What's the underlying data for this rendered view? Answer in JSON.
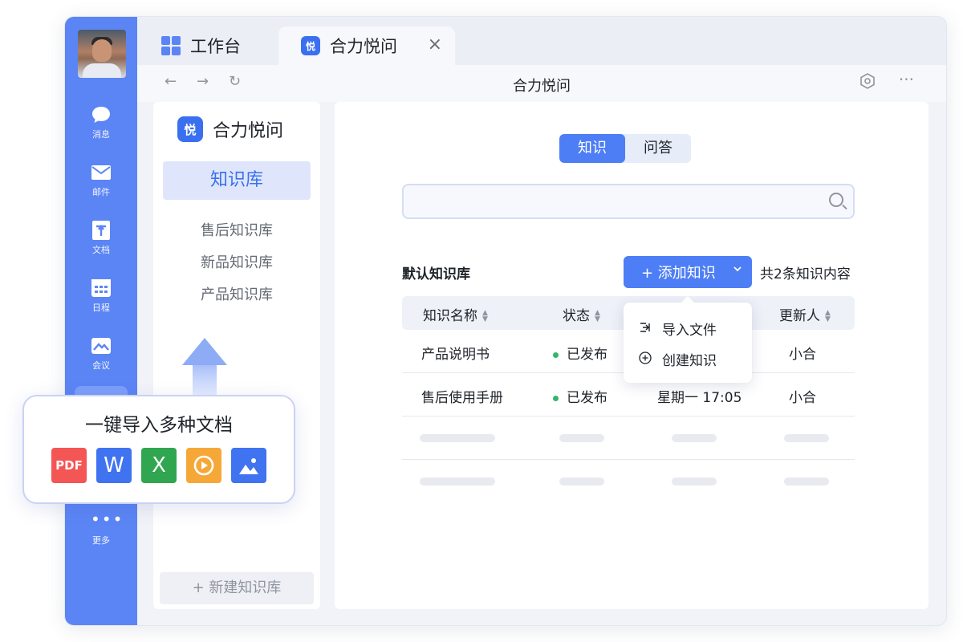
{
  "tabs": {
    "home": "工作台",
    "active": "合力悦问"
  },
  "app_icon_text": "悦",
  "page_title": "合力悦问",
  "rail": [
    {
      "label": "消息",
      "icon": "chat-icon"
    },
    {
      "label": "邮件",
      "icon": "mail-icon"
    },
    {
      "label": "文档",
      "icon": "doc-icon"
    },
    {
      "label": "日程",
      "icon": "calendar-icon"
    },
    {
      "label": "会议",
      "icon": "meeting-icon"
    },
    {
      "label": "更多",
      "icon": "more-icon"
    }
  ],
  "kb_sidebar": {
    "app_name": "合力悦问",
    "active": "知识库",
    "items": [
      "售后知识库",
      "新品知识库",
      "产品知识库"
    ],
    "new_button": "+ 新建知识库"
  },
  "main": {
    "segments": [
      "知识",
      "问答"
    ],
    "active_segment": "知识",
    "search_placeholder": "",
    "library_title": "默认知识库",
    "add_button": "+ 添加知识",
    "count_text": "共2条知识内容",
    "columns": [
      "知识名称",
      "状态",
      "更新人"
    ],
    "rows": [
      {
        "name": "产品说明书",
        "status": "已发布",
        "time": "",
        "updater": "小合"
      },
      {
        "name": "售后使用手册",
        "status": "已发布",
        "time": "星期一  17:05",
        "updater": "小合"
      }
    ],
    "dropdown": [
      "导入文件",
      "创建知识"
    ]
  },
  "popup": {
    "title": "一键导入多种文档",
    "file_types": [
      "PDF",
      "W",
      "X",
      "",
      ""
    ]
  },
  "colors": {
    "accent": "#4d7ef6",
    "rail": "#5b85f5",
    "published": "#34b56b"
  }
}
